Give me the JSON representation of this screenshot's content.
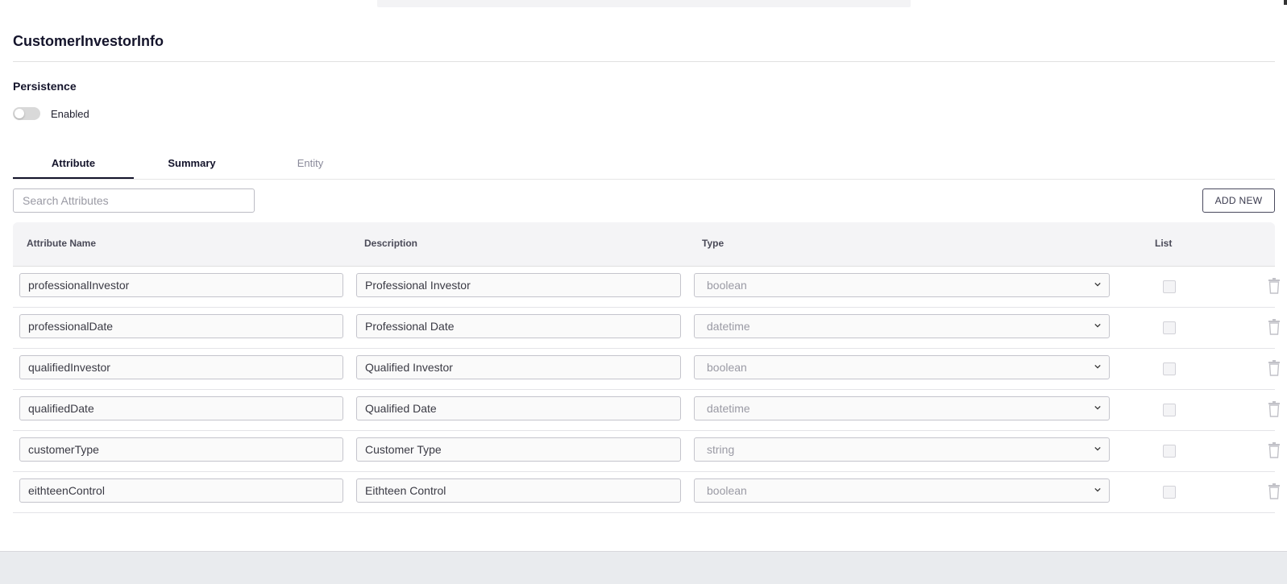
{
  "page": {
    "title": "CustomerInvestorInfo",
    "persistence_label": "Persistence",
    "toggle_label": "Enabled",
    "toggle_on": false
  },
  "tabs": [
    {
      "label": "Attribute",
      "active": true
    },
    {
      "label": "Summary",
      "active": false
    },
    {
      "label": "Entity",
      "active": false
    }
  ],
  "search": {
    "placeholder": "Search Attributes",
    "value": ""
  },
  "add_button": {
    "label": "ADD NEW"
  },
  "table": {
    "headers": [
      "Attribute Name",
      "Description",
      "Type",
      "List"
    ],
    "rows": [
      {
        "name": "professionalInvestor",
        "description": "Professional Investor",
        "type": "boolean",
        "list": false
      },
      {
        "name": "professionalDate",
        "description": "Professional Date",
        "type": "datetime",
        "list": false
      },
      {
        "name": "qualifiedInvestor",
        "description": "Qualified Investor",
        "type": "boolean",
        "list": false
      },
      {
        "name": "qualifiedDate",
        "description": "Qualified Date",
        "type": "datetime",
        "list": false
      },
      {
        "name": "customerType",
        "description": "Customer Type",
        "type": "string",
        "list": false
      },
      {
        "name": "eithteenControl",
        "description": "Eithteen Control",
        "type": "boolean",
        "list": false
      }
    ]
  },
  "icons": {
    "type_dropdown": "chevron-down-icon",
    "row_action": "trash-icon"
  }
}
